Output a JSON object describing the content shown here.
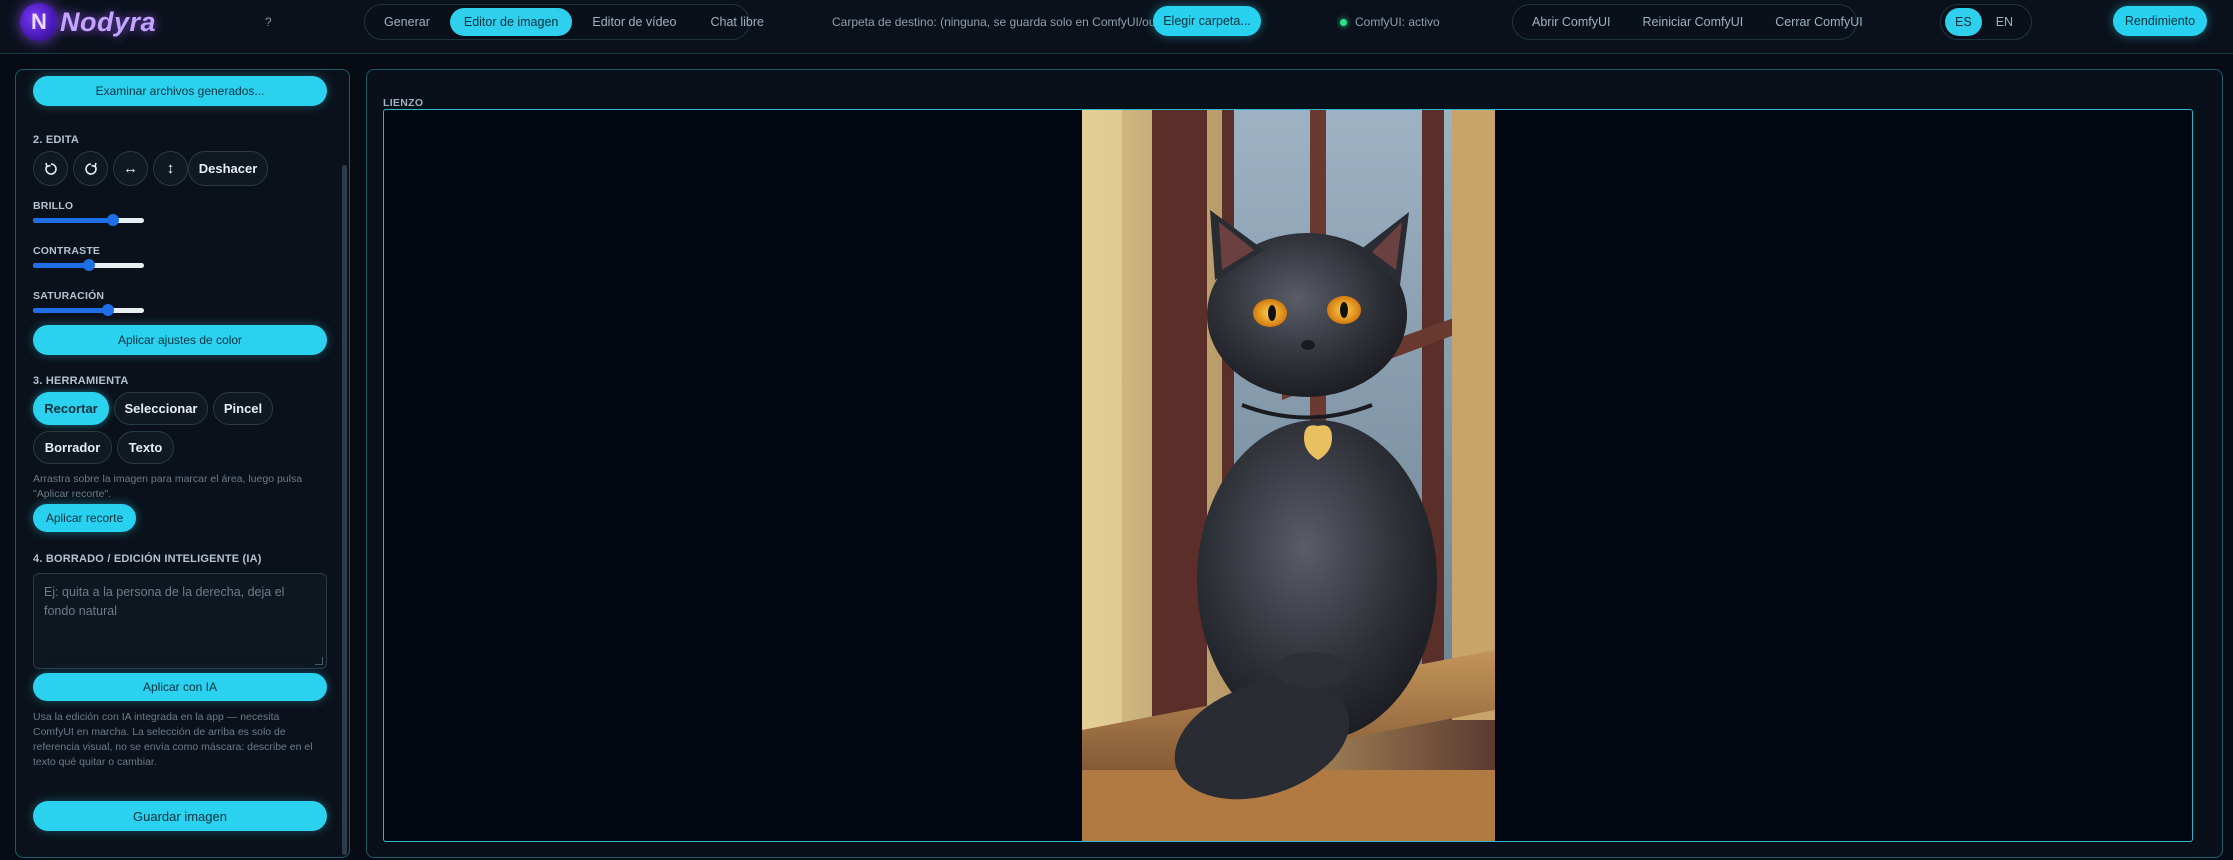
{
  "app": {
    "name": "Nodyra",
    "logo_letter": "N",
    "help": "?"
  },
  "nav": {
    "tabs": [
      {
        "label": "Generar",
        "active": false
      },
      {
        "label": "Editor de imagen",
        "active": true
      },
      {
        "label": "Editor de vídeo",
        "active": false
      },
      {
        "label": "Chat libre",
        "active": false
      }
    ]
  },
  "destination": {
    "text": "Carpeta de destino: (ninguna, se guarda solo en ComfyUI/output)",
    "choose_label": "Elegir carpeta..."
  },
  "comfy": {
    "status": "ComfyUI: activo",
    "status_color": "#2ee08a",
    "open_label": "Abrir ComfyUI",
    "restart_label": "Reiniciar ComfyUI",
    "close_label": "Cerrar ComfyUI"
  },
  "lang": {
    "es": "ES",
    "en": "EN",
    "selected": "ES"
  },
  "performance_label": "Rendimiento",
  "sidebar": {
    "browse_label": "Examinar archivos generados...",
    "edit": {
      "title": "2. EDITA",
      "rotate_left_icon": "rotate-left-icon",
      "rotate_right_icon": "rotate-right-icon",
      "flip_h_icon": "flip-horizontal-icon",
      "flip_v_icon": "flip-vertical-icon",
      "undo_label": "Deshacer"
    },
    "adjust": {
      "brightness_label": "BRILLO",
      "brightness_level": 0.72,
      "contrast_label": "CONTRASTE",
      "contrast_level": 0.5,
      "saturation_label": "SATURACIÓN",
      "saturation_level": 0.68,
      "apply_label": "Aplicar ajustes de color"
    },
    "tool": {
      "title": "3. HERRAMIENTA",
      "crop": "Recortar",
      "select": "Seleccionar",
      "brush": "Pincel",
      "eraser": "Borrador",
      "text": "Texto",
      "active": "Recortar",
      "hint": "Arrastra sobre la imagen para marcar el área, luego pulsa \"Aplicar recorte\".",
      "apply_crop_label": "Aplicar recorte"
    },
    "ai": {
      "title": "4. BORRADO / EDICIÓN INTELIGENTE (IA)",
      "placeholder": "Ej: quita a la persona de la derecha, deja el fondo natural",
      "apply_label": "Aplicar con IA",
      "note": "Usa la edición con IA integrada en la app — necesita ComfyUI en marcha. La selección de arriba es solo de referencia visual, no se envía como máscara: describe en el texto qué quitar o cambiar."
    },
    "save_label": "Guardar imagen"
  },
  "canvas": {
    "label": "LIENZO"
  },
  "colors": {
    "accent": "#2ad2f0",
    "slider": "#1e6fe6",
    "border": "#1d5a6a"
  }
}
